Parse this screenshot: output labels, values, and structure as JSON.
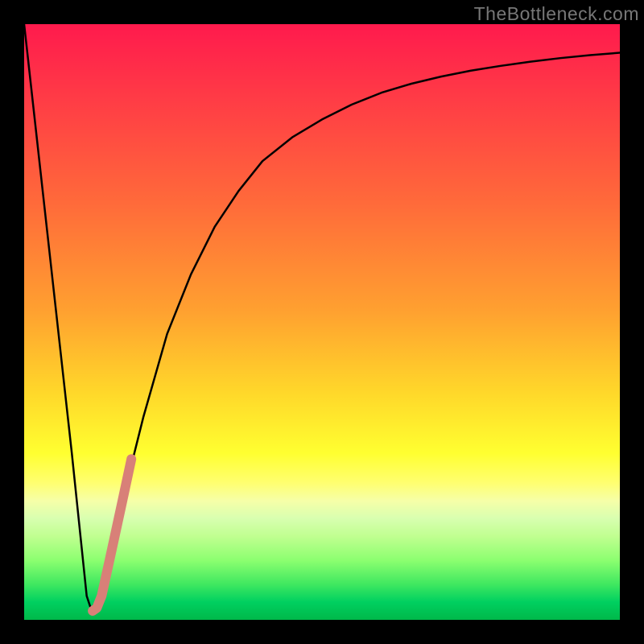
{
  "watermark": {
    "text": "TheBottleneck.com"
  },
  "chart_data": {
    "type": "line",
    "title": "",
    "xlabel": "",
    "ylabel": "",
    "xlim": [
      0,
      100
    ],
    "ylim": [
      0,
      100
    ],
    "grid": false,
    "legend": false,
    "series": [
      {
        "name": "black-curve",
        "color": "#000000",
        "x": [
          0,
          4,
          8,
          10.5,
          11.5,
          13,
          16,
          20,
          24,
          28,
          32,
          36,
          40,
          45,
          50,
          55,
          60,
          65,
          70,
          75,
          80,
          85,
          90,
          95,
          100
        ],
        "y": [
          100,
          64,
          28,
          4,
          1,
          4,
          18,
          34,
          48,
          58,
          66,
          72,
          77,
          81,
          84,
          86.5,
          88.5,
          90,
          91.2,
          92.2,
          93,
          93.7,
          94.3,
          94.8,
          95.2
        ]
      },
      {
        "name": "pink-segment",
        "color": "#d88078",
        "x": [
          11.5,
          12.2,
          13.0,
          14.0,
          15.2,
          16.5,
          18.0
        ],
        "y": [
          1.5,
          2.0,
          4.0,
          8.5,
          14.0,
          20.0,
          27.0
        ]
      }
    ],
    "background_gradient": {
      "direction": "vertical",
      "stops": [
        {
          "pos": 0,
          "color": "#ff1a4d"
        },
        {
          "pos": 30,
          "color": "#ff6a3a"
        },
        {
          "pos": 62,
          "color": "#ffd82a"
        },
        {
          "pos": 77,
          "color": "#ffff70"
        },
        {
          "pos": 86,
          "color": "#c0ff90"
        },
        {
          "pos": 100,
          "color": "#00b84a"
        }
      ]
    }
  }
}
